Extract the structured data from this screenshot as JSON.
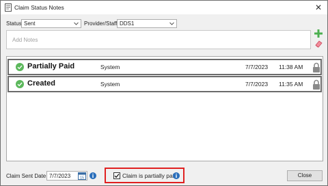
{
  "window": {
    "title": "Claim Status Notes"
  },
  "filters": {
    "status_label": "Status",
    "status_value": "Sent",
    "provider_label": "Provider/Staff",
    "provider_value": "DDS1"
  },
  "notes": {
    "placeholder": "Add Notes"
  },
  "history": [
    {
      "status": "Partially Paid",
      "by": "System",
      "date": "7/7/2023",
      "time": "11:38 AM"
    },
    {
      "status": "Created",
      "by": "System",
      "date": "7/7/2023",
      "time": "11:35 AM"
    }
  ],
  "footer": {
    "sent_date_label": "Claim Sent Date",
    "sent_date_value": "7/7/2023",
    "partial_label": "Claim is partially paid",
    "partial_checked": true,
    "close_label": "Close"
  },
  "colors": {
    "accent_green": "#5cb85c",
    "highlight_red": "#e02020",
    "info_blue": "#2a6ebb"
  },
  "icons": [
    "note-icon",
    "close-icon",
    "chevron-down-icon",
    "add-icon",
    "eraser-icon",
    "check-circle-icon",
    "lock-icon",
    "calendar-icon",
    "info-icon"
  ]
}
